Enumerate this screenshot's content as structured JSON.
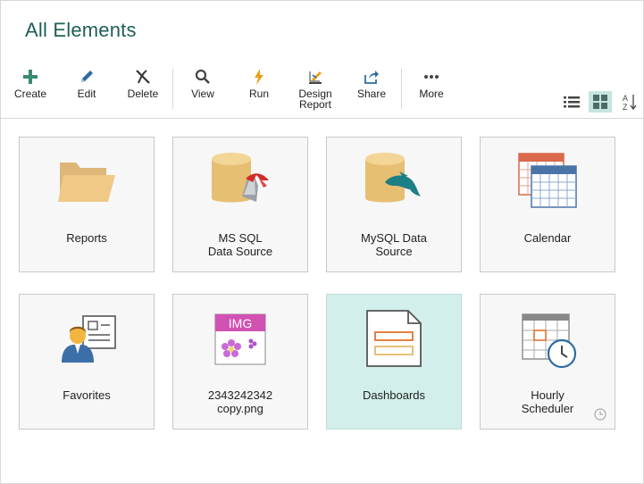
{
  "header": {
    "title": "All Elements"
  },
  "toolbar": {
    "create": "Create",
    "edit": "Edit",
    "delete": "Delete",
    "view": "View",
    "run": "Run",
    "design_report": "Design\nReport",
    "share": "Share",
    "more": "More"
  },
  "view_controls": {
    "list_icon": "list-view-icon",
    "grid_icon": "grid-view-icon",
    "sort_icon": "sort-az-icon",
    "active": "grid"
  },
  "tiles": [
    {
      "label": "Reports",
      "icon": "folder-icon"
    },
    {
      "label": "MS SQL\nData Source",
      "icon": "mssql-datasource-icon"
    },
    {
      "label": "MySQL Data\nSource",
      "icon": "mysql-datasource-icon"
    },
    {
      "label": "Calendar",
      "icon": "calendar-icon"
    },
    {
      "label": "Favorites",
      "icon": "favorites-icon"
    },
    {
      "label": "2343242342\ncopy.png",
      "icon": "image-file-icon",
      "badge": "IMG"
    },
    {
      "label": "Dashboards",
      "icon": "dashboard-icon",
      "selected": true
    },
    {
      "label": "Hourly\nScheduler",
      "icon": "scheduler-icon"
    }
  ],
  "colors": {
    "accent": "#1f5e55",
    "selected_tile": "#d3efeb",
    "tile_bg": "#f7f7f7"
  }
}
